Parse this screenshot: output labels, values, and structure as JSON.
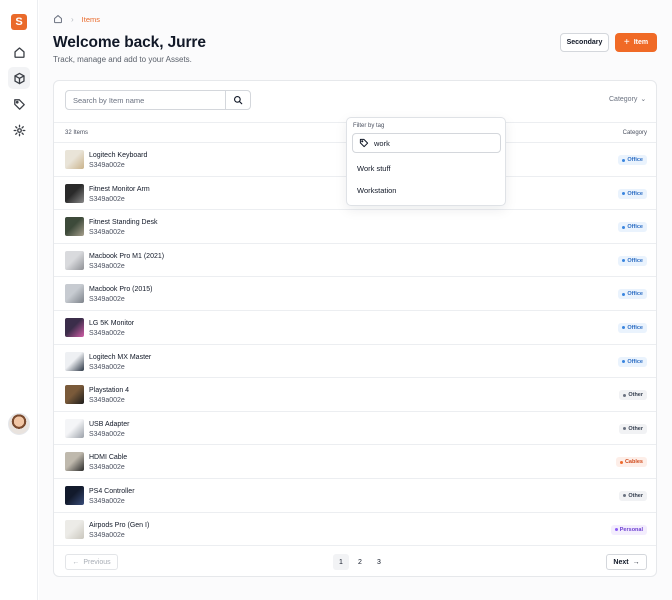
{
  "app": {
    "logo_letter": "S"
  },
  "sidebar": {
    "items": [
      {
        "name": "home",
        "icon": "home-icon"
      },
      {
        "name": "items",
        "icon": "box-icon",
        "active": true
      },
      {
        "name": "tags",
        "icon": "tag-icon"
      },
      {
        "name": "settings",
        "icon": "gear-icon"
      }
    ]
  },
  "breadcrumb": {
    "current": "Items"
  },
  "header": {
    "title": "Welcome back, Jurre",
    "subtitle": "Track, manage and add to your Assets.",
    "secondary_label": "Secondary",
    "primary_label": "Item",
    "primary_icon": "+"
  },
  "search": {
    "placeholder": "Search by Item name",
    "value": ""
  },
  "category_filter": {
    "label": "Category",
    "icon": "⌄"
  },
  "table": {
    "count_label": "32 Items",
    "category_header": "Category",
    "rows": [
      {
        "name": "Logitech Keyboard",
        "id": "S349a002e",
        "category": "Office",
        "thumb": [
          "#e9e4d8",
          "#c9b28a"
        ]
      },
      {
        "name": "Fitnest Monitor Arm",
        "id": "S349a002e",
        "category": "Office",
        "thumb": [
          "#2a2a2a",
          "#8a8a8a"
        ]
      },
      {
        "name": "Fitnest Standing Desk",
        "id": "S349a002e",
        "category": "Office",
        "thumb": [
          "#3d4a3a",
          "#a7a08e"
        ]
      },
      {
        "name": "Macbook Pro M1 (2021)",
        "id": "S349a002e",
        "category": "Office",
        "thumb": [
          "#d9dadd",
          "#8e9095"
        ]
      },
      {
        "name": "Macbook Pro (2015)",
        "id": "S349a002e",
        "category": "Office",
        "thumb": [
          "#c7cbd1",
          "#7d828a"
        ]
      },
      {
        "name": "LG 5K Monitor",
        "id": "S349a002e",
        "category": "Office",
        "thumb": [
          "#3b2d4a",
          "#d35fa8"
        ]
      },
      {
        "name": "Logitech MX Master",
        "id": "S349a002e",
        "category": "Office",
        "thumb": [
          "#eef0f3",
          "#2b3645"
        ]
      },
      {
        "name": "Playstation 4",
        "id": "S349a002e",
        "category": "Other",
        "thumb": [
          "#7a5a3a",
          "#1c1c1c"
        ]
      },
      {
        "name": "USB Adapter",
        "id": "S349a002e",
        "category": "Other",
        "thumb": [
          "#f4f5f7",
          "#9aa0a8"
        ]
      },
      {
        "name": "HDMI Cable",
        "id": "S349a002e",
        "category": "Cables",
        "thumb": [
          "#bfb9ad",
          "#2a2a2a"
        ]
      },
      {
        "name": "PS4 Controller",
        "id": "S349a002e",
        "category": "Other",
        "thumb": [
          "#121a2c",
          "#3a4d7a"
        ]
      },
      {
        "name": "Airpods Pro (Gen I)",
        "id": "S349a002e",
        "category": "Personal",
        "thumb": [
          "#ecebe7",
          "#c9c6bd"
        ]
      }
    ]
  },
  "pagination": {
    "previous_label": "Previous",
    "next_label": "Next",
    "pages": [
      "1",
      "2",
      "3"
    ],
    "current_page": "1"
  },
  "tag_filter": {
    "label": "Filter by tag",
    "search_value": "work",
    "options": [
      "Work stuff",
      "Workstation"
    ]
  },
  "colors": {
    "accent": "#f06a26",
    "office": "#3a86e0",
    "cables": "#ef6a2d",
    "personal": "#8b5cf6",
    "other": "#6b7280"
  }
}
